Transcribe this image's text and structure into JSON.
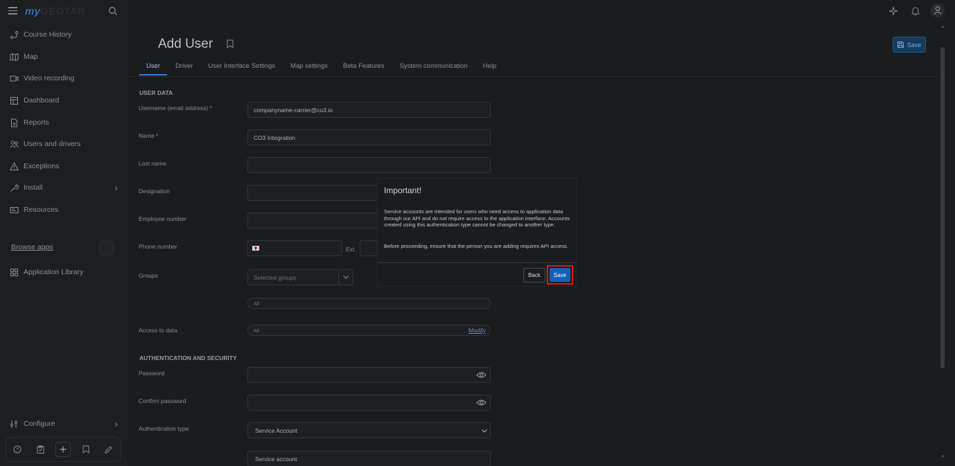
{
  "brand": {
    "logo_my": "my",
    "logo_rest": "GEOTAB"
  },
  "sidebar": {
    "items": [
      {
        "label": "Course History",
        "icon": "route-icon"
      },
      {
        "label": "Map",
        "icon": "map-icon"
      },
      {
        "label": "Video recording",
        "icon": "video-icon"
      },
      {
        "label": "Dashboard",
        "icon": "dashboard-icon"
      },
      {
        "label": "Reports",
        "icon": "report-icon"
      },
      {
        "label": "Users and drivers",
        "icon": "users-icon"
      },
      {
        "label": "Exceptions",
        "icon": "warning-icon"
      },
      {
        "label": "Install",
        "icon": "wrench-icon"
      },
      {
        "label": "Resources",
        "icon": "resources-icon"
      }
    ],
    "browse_apps": "Browse apps",
    "app_library": "Application Library",
    "configure": "Configure"
  },
  "page": {
    "title": "Add User",
    "save_label": "Save",
    "tabs": [
      "User",
      "Driver",
      "User Interface Settings",
      "Map settings",
      "Beta Features",
      "System communication",
      "Help"
    ]
  },
  "form": {
    "section_user": "USER DATA",
    "username_label": "Username (email address) *",
    "username_value": "companyname-carrier@co3.io",
    "name_label": "Name *",
    "name_value": "CO3 Integration",
    "lastname_label": "Last name",
    "designation_label": "Designation",
    "employee_label": "Employee number",
    "phone_label": "Phone number",
    "ext_label": "Ext.",
    "groups_label": "Groups",
    "groups_placeholder": "Selected groups",
    "groups_all": "All",
    "access_label": "Access to data",
    "access_value": "All",
    "modify_label": "Modify",
    "section_auth": "AUTHENTICATION AND SECURITY",
    "password_label": "Password",
    "confirm_label": "Confirm password",
    "authtype_label": "Authentication type",
    "authtype_value": "Service Account",
    "service_account_value": "Service account"
  },
  "modal": {
    "title": "Important!",
    "paragraph1": "Service accounts are intended for users who need access to application data through our API and do not require access to the application interface. Accounts created using this authentication type cannot be changed to another type.",
    "paragraph2": "Before proceeding, ensure that the person you are adding requires API access.",
    "back_label": "Back",
    "save_label": "Save"
  },
  "colors": {
    "accent": "#1560b8",
    "highlight": "#e01818",
    "background": "#1b1c1e"
  }
}
